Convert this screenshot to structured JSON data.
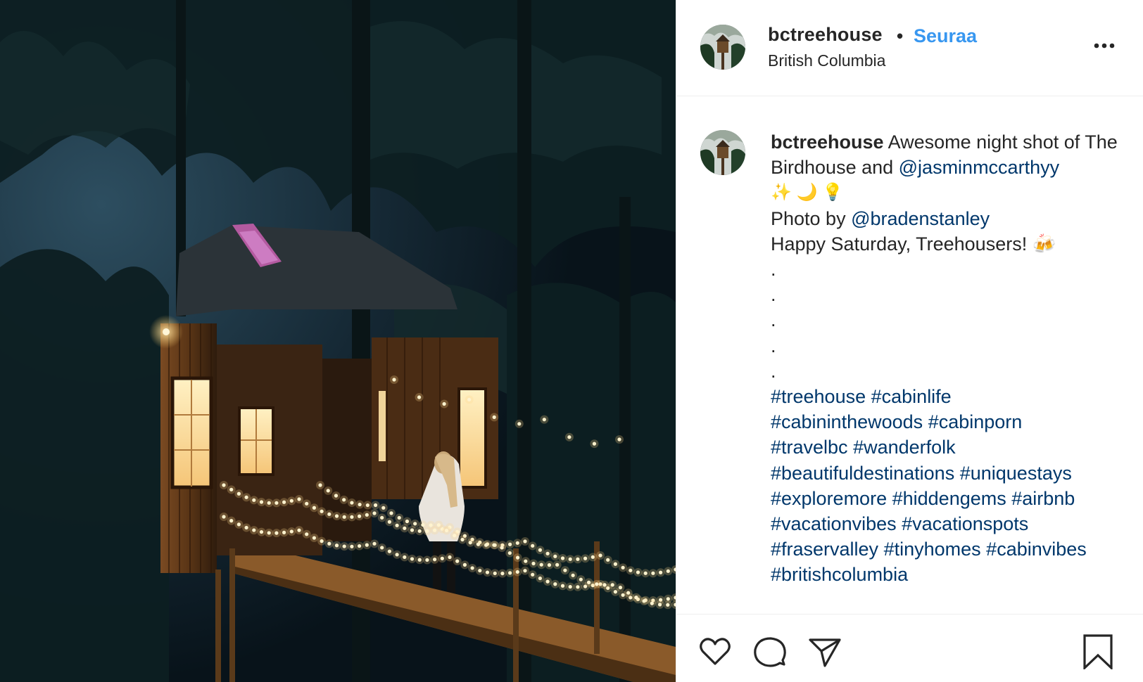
{
  "photo": {
    "alt_icon": "treehouse-photo"
  },
  "header": {
    "username": "bctreehouse",
    "separator": "•",
    "follow_label": "Seuraa",
    "location": "British Columbia",
    "more_icon": "more-options-icon"
  },
  "caption": {
    "username": "bctreehouse",
    "text_before_mention": " Awesome night shot of The Birdhouse and ",
    "mention_1": "@jasminmccarthyy",
    "emoji_line": "✨ 🌙 💡",
    "photo_by": "Photo by ",
    "mention_2": "@bradenstanley",
    "greeting": "Happy Saturday, Treehousers! 🍻",
    "dots": [
      ".",
      ".",
      ".",
      ".",
      "."
    ],
    "hashtag_lines": [
      [
        "#treehouse",
        "#cabinlife"
      ],
      [
        "#cabininthewoods",
        "#cabinporn"
      ],
      [
        "#travelbc",
        "#wanderfolk"
      ],
      [
        "#beautifuldestinations",
        "#uniquestays"
      ],
      [
        "#exploremore",
        "#hiddengems",
        "#airbnb"
      ],
      [
        "#vacationvibes",
        "#vacationspots"
      ],
      [
        "#fraservalley",
        "#tinyhomes",
        "#cabinvibes"
      ],
      [
        "#britishcolumbia"
      ]
    ]
  },
  "actions": {
    "like_icon": "heart-icon",
    "comment_icon": "comment-icon",
    "share_icon": "share-icon",
    "save_icon": "bookmark-icon"
  },
  "colors": {
    "follow": "#3897f0",
    "link": "#00376b",
    "text": "#262626",
    "border": "#efefef"
  }
}
